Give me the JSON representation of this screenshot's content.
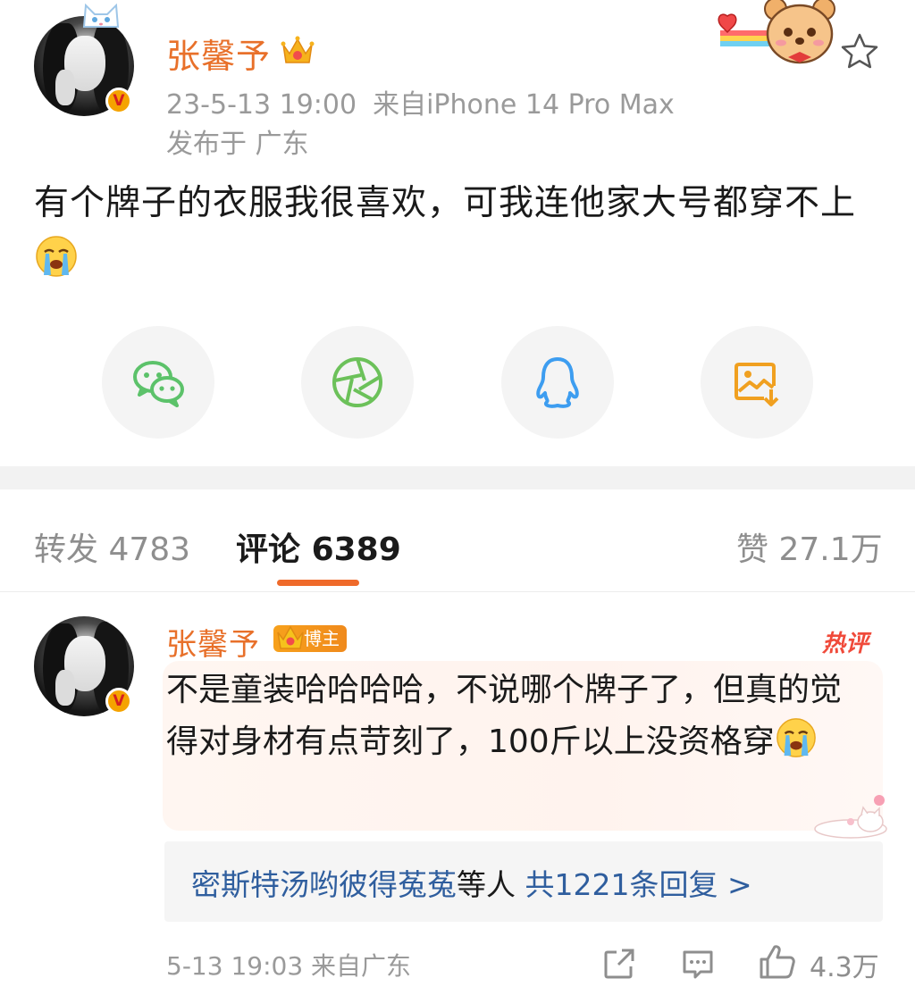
{
  "post": {
    "author": "张馨予",
    "timestamp": "23-5-13 19:00",
    "source": "来自iPhone 14 Pro Max",
    "location": "发布于 广东",
    "text": "有个牌子的衣服我很喜欢，可我连他家大号都穿不上"
  },
  "share": {
    "items": [
      "wechat-icon",
      "moments-icon",
      "qq-icon",
      "save-image-icon"
    ],
    "colors": {
      "wechat": "#5cc26a",
      "moments": "#6cc15a",
      "qq": "#3d9df0",
      "save": "#f0a020"
    }
  },
  "tabs": {
    "repost_label": "转发",
    "repost_count": "4783",
    "comment_label": "评论",
    "comment_count": "6389",
    "like_label": "赞",
    "like_count": "27.1万"
  },
  "comment": {
    "author": "张馨予",
    "badge": "博主",
    "hot_tag": "热评",
    "text": "不是童装哈哈哈哈，不说哪个牌子了，但真的觉得对身材有点苛刻了，100斤以上没资格穿",
    "reply_names": "密斯特汤哟彼得菟菟",
    "reply_mid": "等人",
    "reply_count": "共1221条回复 >",
    "time": "5-13 19:03",
    "location": "来自广东",
    "likes": "4.3万"
  },
  "colors": {
    "accent": "#e8702a",
    "link": "#2f5e9e",
    "hot": "#f04a3a",
    "tab_indicator": "#ef6a2a"
  }
}
